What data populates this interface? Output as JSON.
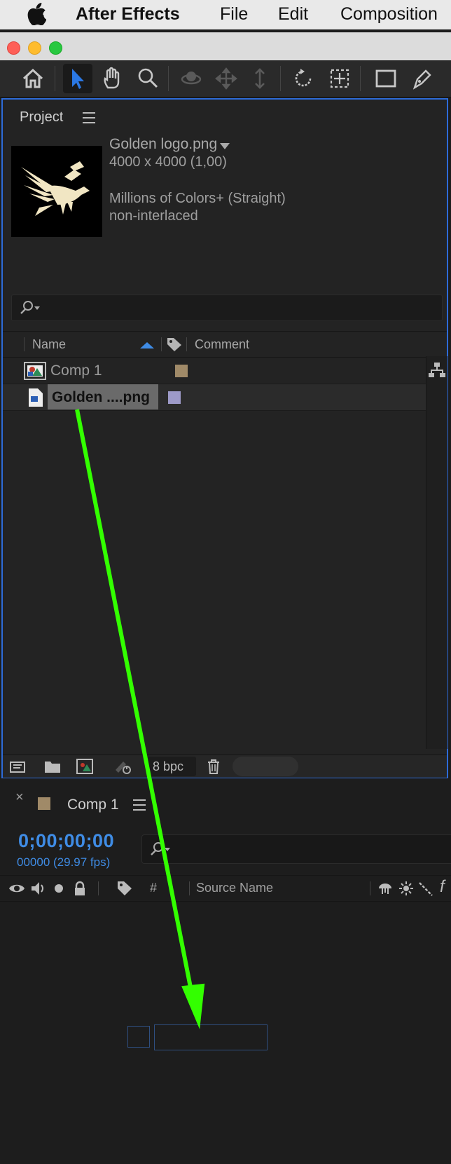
{
  "menubar": {
    "app_name": "After Effects",
    "items": [
      "File",
      "Edit",
      "Composition"
    ]
  },
  "window": {
    "controls": [
      "close",
      "minimize",
      "zoom"
    ]
  },
  "toolbar": {
    "tools": [
      "home-icon",
      "selection-tool-icon",
      "hand-tool-icon",
      "zoom-tool-icon",
      "orbit-camera-icon",
      "pan-camera-icon",
      "dolly-camera-icon",
      "rotation-tool-icon",
      "pan-behind-icon",
      "rectangle-tool-icon",
      "pen-tool-icon"
    ]
  },
  "project": {
    "title": "Project",
    "selected_file": {
      "name": "Golden logo.png",
      "dimensions": "4000 x 4000 (1,00)",
      "colors": "Millions of Colors+ (Straight)",
      "interlace": "non-interlaced"
    },
    "columns": {
      "name": "Name",
      "comment": "Comment"
    },
    "items": [
      {
        "label": "Comp 1",
        "type": "composition",
        "color": "#a08a68"
      },
      {
        "label": "Golden ....png",
        "type": "image",
        "color": "#9d9ac8",
        "selected": true
      }
    ],
    "bit_depth": "8 bpc"
  },
  "timeline": {
    "comp_name": "Comp 1",
    "comp_color": "#a08a68",
    "timecode": "0;00;00;00",
    "frame_info": "00000 (29.97 fps)",
    "columns": {
      "number": "#",
      "source_name": "Source Name"
    }
  },
  "colors": {
    "accent_blue": "#3f8ce5",
    "panel_border": "#2d6bd8",
    "drag_arrow": "#33ff00"
  }
}
